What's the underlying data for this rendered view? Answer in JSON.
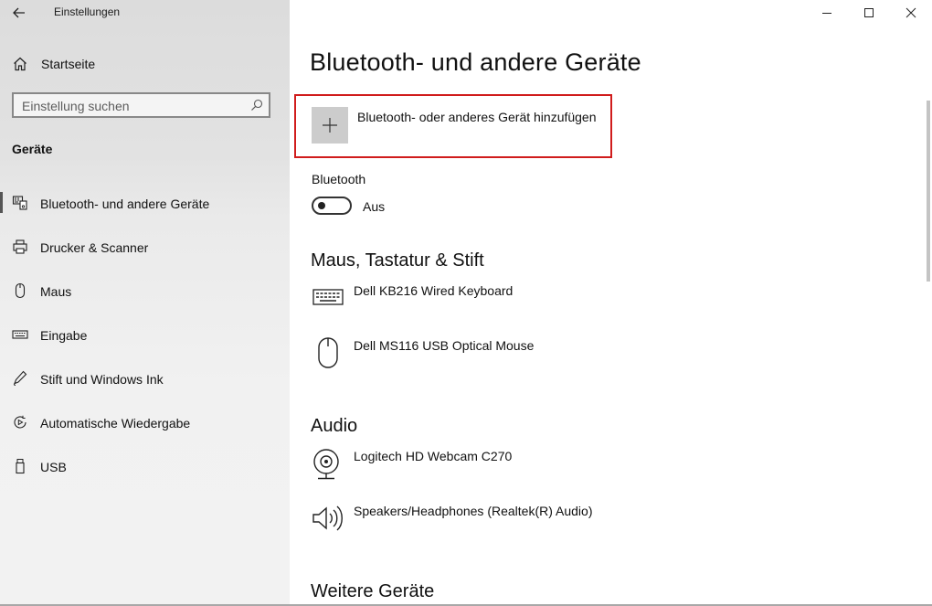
{
  "window": {
    "app_title": "Einstellungen",
    "controls": [
      "minimize-icon",
      "maximize-icon",
      "close-icon"
    ]
  },
  "sidebar": {
    "home_label": "Startseite",
    "search": {
      "placeholder": "Einstellung suchen",
      "value": ""
    },
    "section_title": "Geräte",
    "items": [
      {
        "label": "Bluetooth- und andere Geräte",
        "icon": "bluetooth-devices-icon",
        "active": true
      },
      {
        "label": "Drucker & Scanner",
        "icon": "printer-icon",
        "active": false
      },
      {
        "label": "Maus",
        "icon": "mouse-icon",
        "active": false
      },
      {
        "label": "Eingabe",
        "icon": "keyboard-icon",
        "active": false
      },
      {
        "label": "Stift und Windows Ink",
        "icon": "pen-icon",
        "active": false
      },
      {
        "label": "Automatische Wiedergabe",
        "icon": "autoplay-icon",
        "active": false
      },
      {
        "label": "USB",
        "icon": "usb-icon",
        "active": false
      }
    ]
  },
  "main": {
    "page_title": "Bluetooth- und andere Geräte",
    "add_device_label": "Bluetooth- oder anderes Gerät hinzufügen",
    "bluetooth": {
      "label": "Bluetooth",
      "state_label": "Aus",
      "on": false
    },
    "groups": [
      {
        "title": "Maus, Tastatur & Stift",
        "devices": [
          {
            "name": "Dell KB216 Wired Keyboard",
            "icon": "keyboard-icon"
          },
          {
            "name": "Dell MS116 USB Optical Mouse",
            "icon": "mouse-icon"
          }
        ]
      },
      {
        "title": "Audio",
        "devices": [
          {
            "name": "Logitech HD Webcam C270",
            "icon": "webcam-icon"
          },
          {
            "name": "Speakers/Headphones (Realtek(R) Audio)",
            "icon": "speaker-icon"
          }
        ]
      },
      {
        "title": "Weitere Geräte",
        "devices": []
      }
    ]
  },
  "colors": {
    "highlight_border": "#d01c1c",
    "sidebar_bg": "#e6e6e6",
    "plus_tile": "#cccccc"
  }
}
